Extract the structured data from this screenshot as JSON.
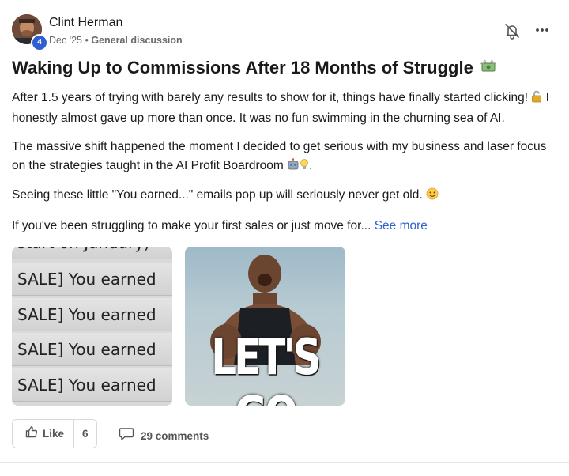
{
  "author": {
    "name": "Clint Herman",
    "level": "4"
  },
  "meta": {
    "date": "Dec '25",
    "separator": " • ",
    "category": "General discussion"
  },
  "title": "Waking Up to Commissions After 18 Months of Struggle",
  "body": {
    "p1": "After 1.5 years of trying with barely any results to show for it, things have finally started clicking!",
    "p1_tail": " I honestly almost gave up more than once. It was no fun swimming in the churning sea of AI.",
    "p2": "The massive shift happened the moment I decided to get serious with my business and laser focus on the strategies taught in the AI Profit Boardroom",
    "p2_tail": ".",
    "p3": "Seeing these little \"You earned...\" emails pop up will seriously never get old.",
    "p4": "If you've been struggling to make your first sales or just move for...",
    "see_more": "See more"
  },
  "images": {
    "left_partial": "start on January)",
    "left_rows": [
      "SALE] You earned",
      "SALE] You earned",
      "SALE] You earned",
      "SALE] You earned"
    ],
    "right_caption": "LET'S GO"
  },
  "actions": {
    "like_label": "Like",
    "like_count": "6",
    "comments_label": "29 comments"
  },
  "icons": {
    "title_emoji": "money-with-wings-icon",
    "bell": "bell-off-icon",
    "more": "more-horizontal-icon",
    "lock": "unlocked-icon",
    "robot": "robot-icon",
    "bulb": "lightbulb-icon",
    "smile": "smile-icon",
    "like": "thumbs-up-icon",
    "comment": "comment-icon"
  },
  "colors": {
    "accent": "#2f5fd0",
    "badge": "#2f5fd0",
    "text": "#1a1a1a",
    "muted": "#6b6b6b"
  }
}
